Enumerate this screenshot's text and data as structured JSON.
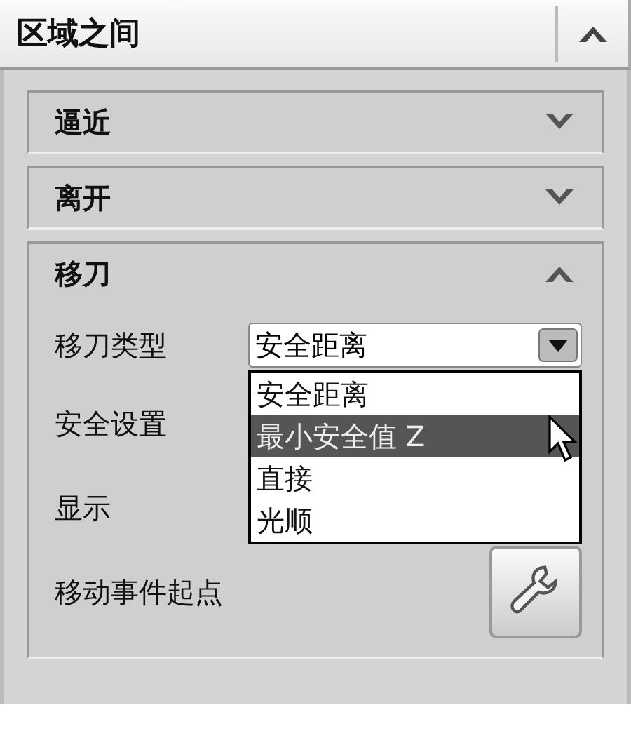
{
  "panel": {
    "title": "区域之间",
    "expanded": true
  },
  "sections": [
    {
      "title": "逼近",
      "expanded": false
    },
    {
      "title": "离开",
      "expanded": false
    },
    {
      "title": "移刀",
      "expanded": true,
      "rows": [
        {
          "kind": "dropdown",
          "label": "移刀类型",
          "value": "安全距离",
          "expanded": true,
          "options": [
            {
              "label": "安全距离",
              "highlighted": false
            },
            {
              "label": "最小安全值 Z",
              "highlighted": true
            },
            {
              "label": "直接",
              "highlighted": false
            },
            {
              "label": "光顺",
              "highlighted": false
            }
          ]
        },
        {
          "kind": "label",
          "label": "安全设置"
        },
        {
          "kind": "label",
          "label": "显示"
        },
        {
          "kind": "button",
          "label": "移动事件起点"
        }
      ]
    }
  ]
}
